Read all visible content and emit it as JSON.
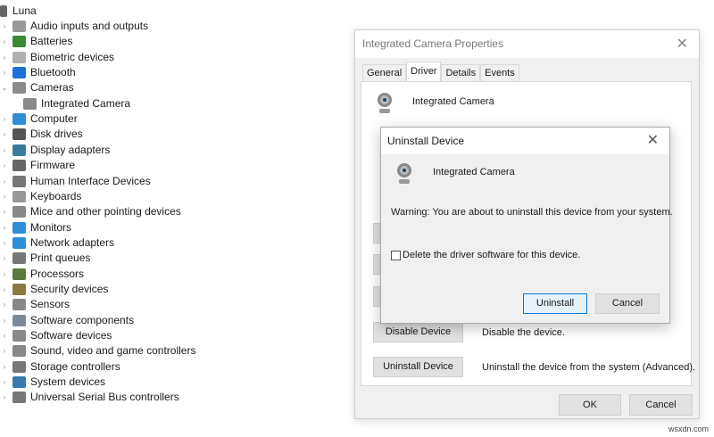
{
  "tree": {
    "root": "Luna",
    "items": [
      {
        "label": "Audio inputs and outputs",
        "icon": "speaker-icon",
        "color": "#9a9a9a"
      },
      {
        "label": "Batteries",
        "icon": "battery-icon",
        "color": "#3a8a3a"
      },
      {
        "label": "Biometric devices",
        "icon": "fingerprint-icon",
        "color": "#b0b0b0"
      },
      {
        "label": "Bluetooth",
        "icon": "bluetooth-icon",
        "color": "#1e6fd9"
      },
      {
        "label": "Cameras",
        "icon": "camera-icon",
        "color": "#8a8a8a",
        "expanded": true
      },
      {
        "label": "Integrated Camera",
        "icon": "camera-icon",
        "color": "#8a8a8a",
        "child": true
      },
      {
        "label": "Computer",
        "icon": "monitor-icon",
        "color": "#2e8fd8"
      },
      {
        "label": "Disk drives",
        "icon": "disk-drive-icon",
        "color": "#555"
      },
      {
        "label": "Display adapters",
        "icon": "display-adapter-icon",
        "color": "#3a7a9a"
      },
      {
        "label": "Firmware",
        "icon": "firmware-icon",
        "color": "#666"
      },
      {
        "label": "Human Interface Devices",
        "icon": "hid-icon",
        "color": "#777"
      },
      {
        "label": "Keyboards",
        "icon": "keyboard-icon",
        "color": "#999"
      },
      {
        "label": "Mice and other pointing devices",
        "icon": "mouse-icon",
        "color": "#888"
      },
      {
        "label": "Monitors",
        "icon": "monitor-icon",
        "color": "#2e8fd8"
      },
      {
        "label": "Network adapters",
        "icon": "network-icon",
        "color": "#2e8fd8"
      },
      {
        "label": "Print queues",
        "icon": "printer-icon",
        "color": "#777"
      },
      {
        "label": "Processors",
        "icon": "processor-icon",
        "color": "#5a7a3a"
      },
      {
        "label": "Security devices",
        "icon": "security-icon",
        "color": "#8a7a40"
      },
      {
        "label": "Sensors",
        "icon": "sensor-icon",
        "color": "#888"
      },
      {
        "label": "Software components",
        "icon": "software-component-icon",
        "color": "#7a8a9a"
      },
      {
        "label": "Software devices",
        "icon": "software-device-icon",
        "color": "#888"
      },
      {
        "label": "Sound, video and game controllers",
        "icon": "sound-icon",
        "color": "#888"
      },
      {
        "label": "Storage controllers",
        "icon": "storage-icon",
        "color": "#777"
      },
      {
        "label": "System devices",
        "icon": "system-icon",
        "color": "#3a7ab0"
      },
      {
        "label": "Universal Serial Bus controllers",
        "icon": "usb-icon",
        "color": "#777"
      }
    ]
  },
  "properties": {
    "title": "Integrated Camera Properties",
    "tabs": [
      "General",
      "Driver",
      "Details",
      "Events"
    ],
    "active_tab": "Driver",
    "device_name": "Integrated Camera",
    "disable_button": "Disable Device",
    "disable_desc": "Disable the device.",
    "uninstall_button": "Uninstall Device",
    "uninstall_desc": "Uninstall the device from the system (Advanced).",
    "ok": "OK",
    "cancel": "Cancel"
  },
  "uninstall_dialog": {
    "title": "Uninstall Device",
    "device_name": "Integrated Camera",
    "warning": "Warning: You are about to uninstall this device from your system.",
    "checkbox_label": "Delete the driver software for this device.",
    "checkbox_checked": false,
    "uninstall": "Uninstall",
    "cancel": "Cancel"
  },
  "watermark": "wsxdn.com"
}
